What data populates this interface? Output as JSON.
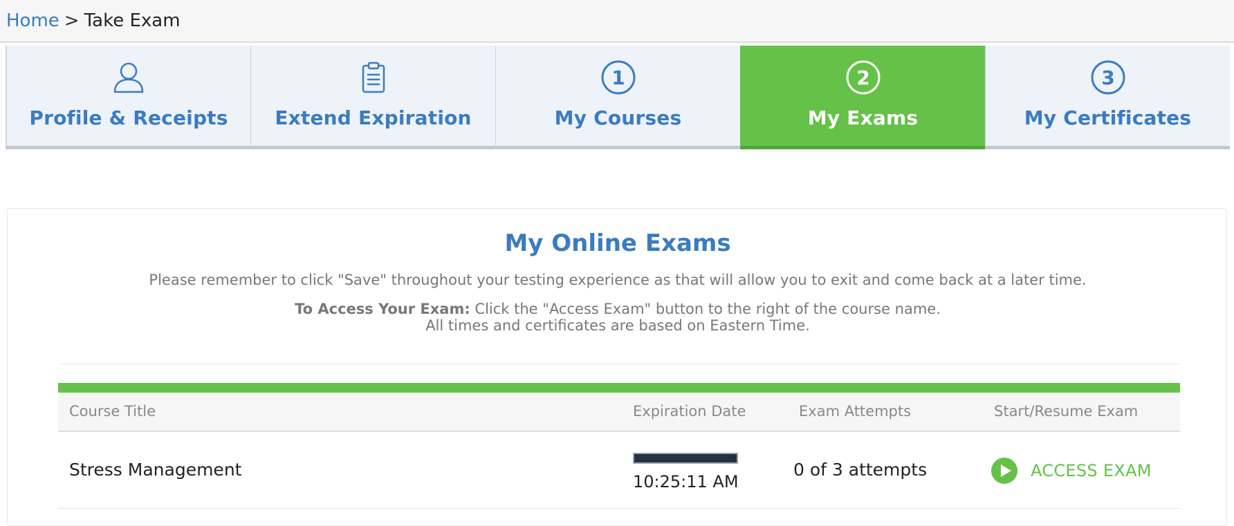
{
  "breadcrumb": {
    "home": "Home",
    "separator": ">",
    "current": "Take Exam"
  },
  "tabs": [
    {
      "label": "Profile & Receipts",
      "icon": "user-icon",
      "active": false
    },
    {
      "label": "Extend Expiration",
      "icon": "clipboard-icon",
      "active": false
    },
    {
      "label": "My Courses",
      "icon": "step-1-icon",
      "step": "1",
      "active": false
    },
    {
      "label": "My Exams",
      "icon": "step-2-icon",
      "step": "2",
      "active": true
    },
    {
      "label": "My Certificates",
      "icon": "step-3-icon",
      "step": "3",
      "active": false
    }
  ],
  "main": {
    "title": "My Online Exams",
    "note": "Please remember to click \"Save\" throughout your testing experience as that will allow you to exit and come back at a later time.",
    "access_bold": "To Access Your Exam:",
    "access_text": " Click the \"Access Exam\" button to the right of the course name.",
    "time_note": "All times and certificates are based on Eastern Time."
  },
  "table": {
    "headers": {
      "course": "Course Title",
      "expiration": "Expiration Date",
      "attempts": "Exam Attempts",
      "action": "Start/Resume Exam"
    },
    "rows": [
      {
        "course": "Stress Management",
        "expiration_time": "10:25:11 AM",
        "attempts": "0 of 3 attempts",
        "action_label": "ACCESS EXAM"
      }
    ]
  },
  "colors": {
    "accent_blue": "#3a7cc0",
    "accent_green": "#65c148"
  }
}
